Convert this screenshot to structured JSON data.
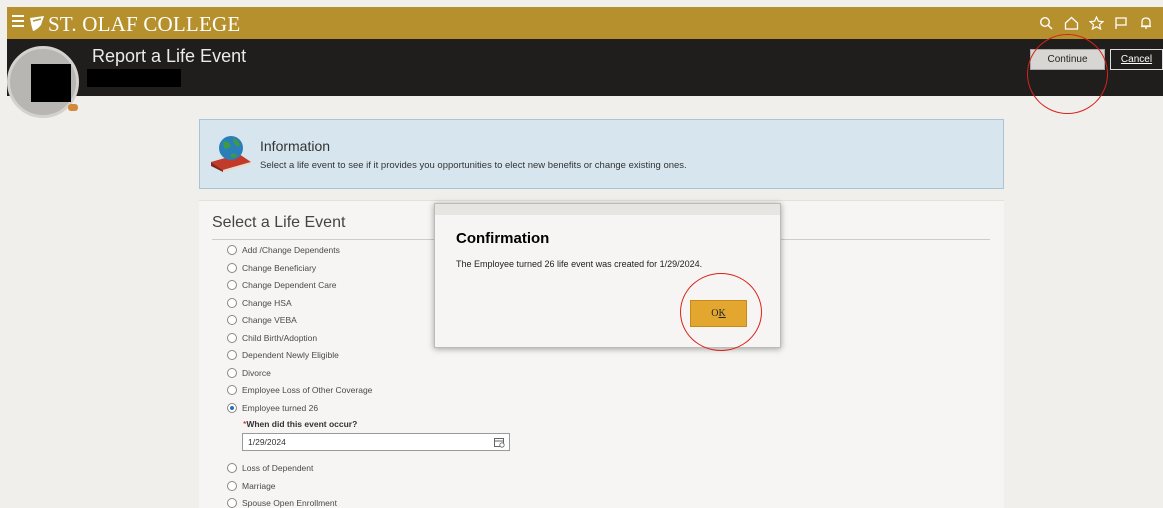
{
  "topbar": {
    "brand": "ST. OLAF COLLEGE",
    "icons": [
      "menu-icon",
      "search-icon",
      "home-icon",
      "favorites-icon",
      "flag-icon",
      "notifications-icon"
    ]
  },
  "header": {
    "title": "Report a Life Event",
    "continue_label": "Continue",
    "cancel_label": "Cancel"
  },
  "info": {
    "title": "Information",
    "text": "Select a life event to see if it provides you opportunities to elect new benefits or change existing ones."
  },
  "life_event": {
    "title": "Select a Life Event",
    "options": [
      {
        "label": "Add /Change Dependents",
        "selected": false
      },
      {
        "label": "Change Beneficiary",
        "selected": false
      },
      {
        "label": "Change Dependent Care",
        "selected": false
      },
      {
        "label": "Change HSA",
        "selected": false
      },
      {
        "label": "Change VEBA",
        "selected": false
      },
      {
        "label": "Child Birth/Adoption",
        "selected": false
      },
      {
        "label": "Dependent Newly Eligible",
        "selected": false
      },
      {
        "label": "Divorce",
        "selected": false
      },
      {
        "label": "Employee Loss of Other Coverage",
        "selected": false
      },
      {
        "label": "Employee turned 26",
        "selected": true
      },
      {
        "label": "Loss of Dependent",
        "selected": false
      },
      {
        "label": "Marriage",
        "selected": false
      },
      {
        "label": "Spouse Open Enrollment",
        "selected": false
      }
    ],
    "date_required_mark": "*",
    "date_label": "When did this event occur?",
    "date_value": "1/29/2024"
  },
  "dialog": {
    "title": "Confirmation",
    "message": "The Employee turned 26 life event was created for 1/29/2024.",
    "ok_label_pre": "O",
    "ok_label_underlined": "K"
  },
  "colors": {
    "topbar": "#b5902d",
    "header": "#1f1e1c",
    "ok_button": "#e3a730",
    "annotation": "#d9221a"
  }
}
